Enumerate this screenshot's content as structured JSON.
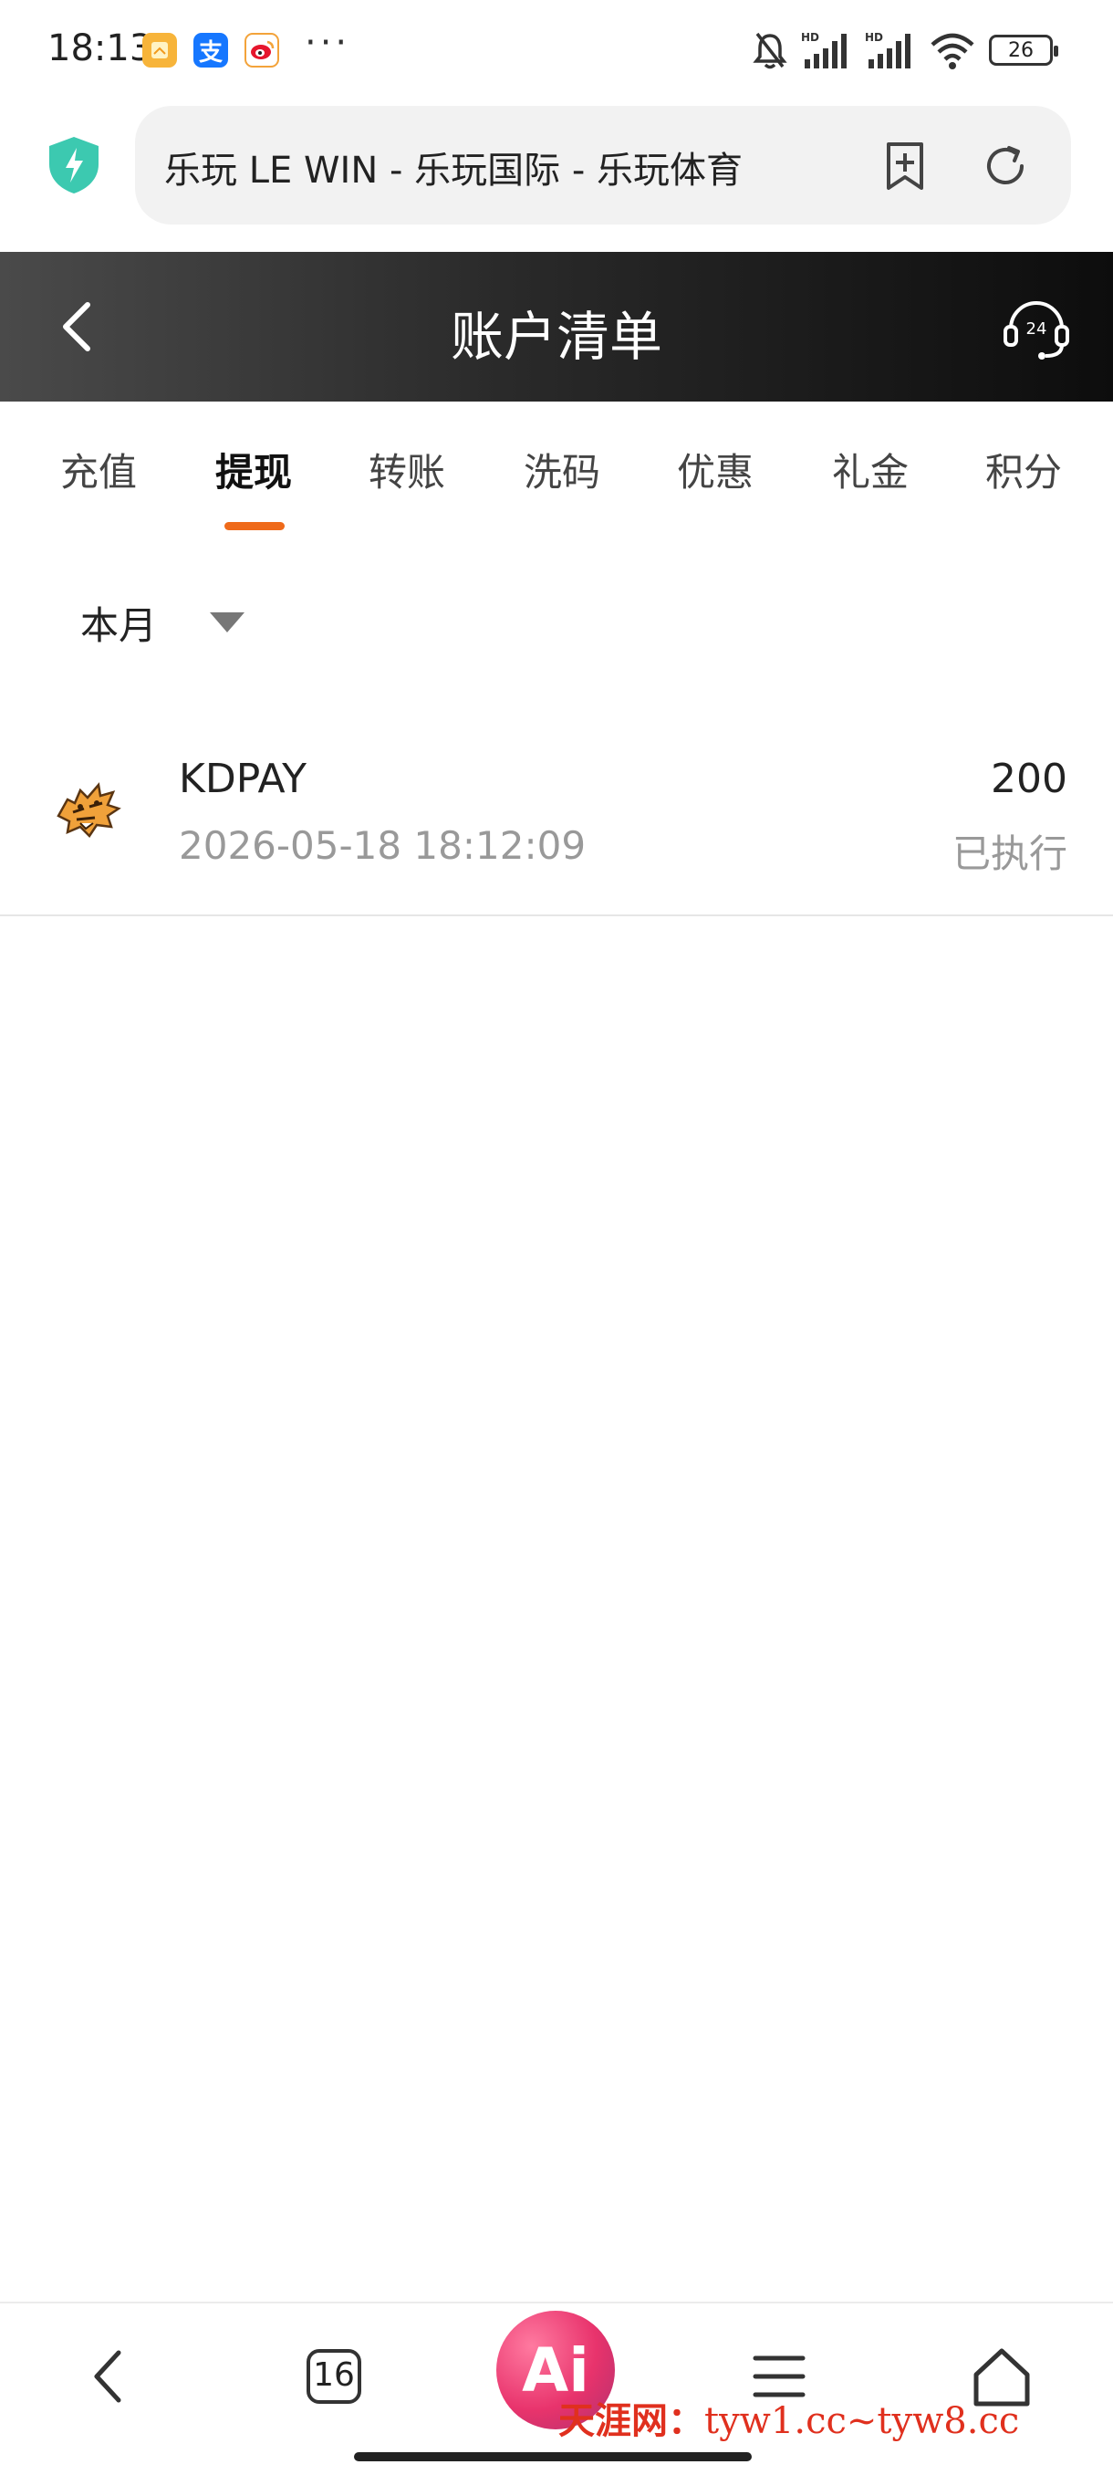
{
  "status_bar": {
    "time": "18:13",
    "dots": "···",
    "battery": "26",
    "app_icons": [
      "notes-icon",
      "alipay-icon",
      "weibo-icon"
    ],
    "alipay_glyph": "支",
    "hd_label": "HD"
  },
  "browser": {
    "address": "乐玩 LE WIN - 乐玩国际 - 乐玩体育",
    "security_icon": "shield-lightning-icon"
  },
  "header": {
    "title": "账户清单",
    "support_label": "24"
  },
  "tabs": [
    {
      "label": "充值",
      "active": false
    },
    {
      "label": "提现",
      "active": true
    },
    {
      "label": "转账",
      "active": false
    },
    {
      "label": "洗码",
      "active": false
    },
    {
      "label": "优惠",
      "active": false
    },
    {
      "label": "礼金",
      "active": false
    },
    {
      "label": "积分",
      "active": false
    }
  ],
  "filter": {
    "selected": "本月"
  },
  "records": [
    {
      "name": "KDPAY",
      "time": "2026-05-18 18:12:09",
      "amount": "200",
      "status": "已执行"
    }
  ],
  "bottom_nav": {
    "tab_count": "16",
    "ai_label": "Ai"
  },
  "watermark": {
    "site": "天涯网：",
    "url": "tyw1.cc~tyw8.cc"
  },
  "colors": {
    "accent": "#ef6a1a",
    "shield": "#3cc9b0",
    "ai": "#e8336c",
    "watermark": "#e0301e"
  }
}
